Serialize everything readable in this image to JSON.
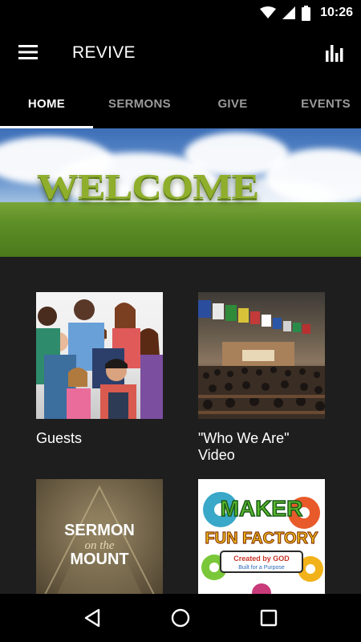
{
  "status_bar": {
    "time": "10:26"
  },
  "app_bar": {
    "title": "REVIVE",
    "menu_icon": "hamburger-icon",
    "action_icon": "bar-chart-icon"
  },
  "tabs": [
    {
      "label": "HOME",
      "active": true
    },
    {
      "label": "SERMONS",
      "active": false
    },
    {
      "label": "GIVE",
      "active": false
    },
    {
      "label": "EVENTS",
      "active": false
    }
  ],
  "banner": {
    "text": "WELCOME"
  },
  "tiles": [
    {
      "label": "Guests"
    },
    {
      "label": "\"Who We Are\" Video"
    },
    {
      "label": "",
      "image_text": [
        "SERMON",
        "on the",
        "MOUNT"
      ]
    },
    {
      "label": "",
      "image_text": [
        "MAKER",
        "FUN FACTORY",
        "Created by GOD",
        "Built for a Purpose"
      ]
    }
  ],
  "nav_bar": {
    "back_icon": "back-icon",
    "home_icon": "home-icon",
    "recents_icon": "recents-icon"
  }
}
